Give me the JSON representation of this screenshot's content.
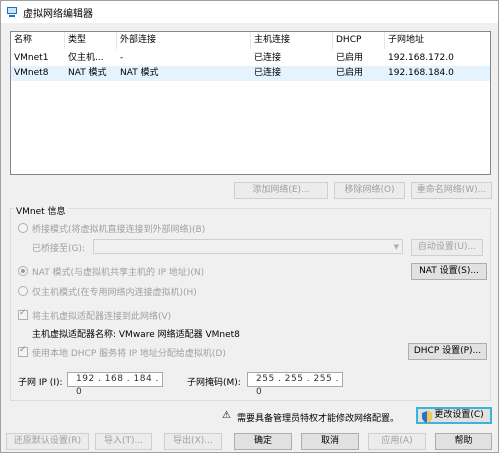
{
  "window": {
    "title": "虚拟网络编辑器"
  },
  "table": {
    "columns": [
      "名称",
      "类型",
      "外部连接",
      "主机连接",
      "DHCP",
      "子网地址"
    ],
    "rows": [
      [
        "VMnet1",
        "仅主机...",
        "-",
        "已连接",
        "已启用",
        "192.168.172.0"
      ],
      [
        "VMnet8",
        "NAT 模式",
        "NAT 模式",
        "已连接",
        "已启用",
        "192.168.184.0"
      ]
    ]
  },
  "list_buttons": {
    "add": "添加网络(E)...",
    "remove": "移除网络(O)",
    "rename": "重命名网络(W)..."
  },
  "vmnet_info": {
    "label": "VMnet 信息",
    "bridge_radio": "桥接模式(将虚拟机直接连接到外部网络)(B)",
    "bridge_to_label": "已桥接至(G):",
    "auto_settings": "自动设置(U)...",
    "nat_radio": "NAT 模式(与虚拟机共享主机的 IP 地址)(N)",
    "nat_settings": "NAT 设置(S)...",
    "host_only_radio": "仅主机模式(在专用网络内连接虚拟机)(H)",
    "connect_adapter_check": "将主机虚拟适配器连接到此网络(V)",
    "adapter_name_label": "主机虚拟适配器名称: VMware 网络适配器 VMnet8",
    "dhcp_check": "使用本地 DHCP 服务将 IP 地址分配给虚拟机(D)",
    "dhcp_settings": "DHCP 设置(P)...",
    "subnet_ip_label": "子网 IP (I):",
    "subnet_ip_value": "192 . 168 . 184 . 0",
    "subnet_mask_label": "子网掩码(M):",
    "subnet_mask_value": "255 . 255 . 255 . 0"
  },
  "admin_notice": "需要具备管理员特权才能修改网络配置。",
  "change_settings": "更改设置(C)",
  "footer_buttons": {
    "restore": "还原默认设置(R)",
    "import": "导入(T)...",
    "export": "导出(X)...",
    "ok": "确定",
    "cancel": "取消",
    "apply": "应用(A)",
    "help": "帮助"
  },
  "colors": {
    "accent": "#1a73c7",
    "selection": "#e5f3ff",
    "highlight_border": "#3cb4d8"
  }
}
